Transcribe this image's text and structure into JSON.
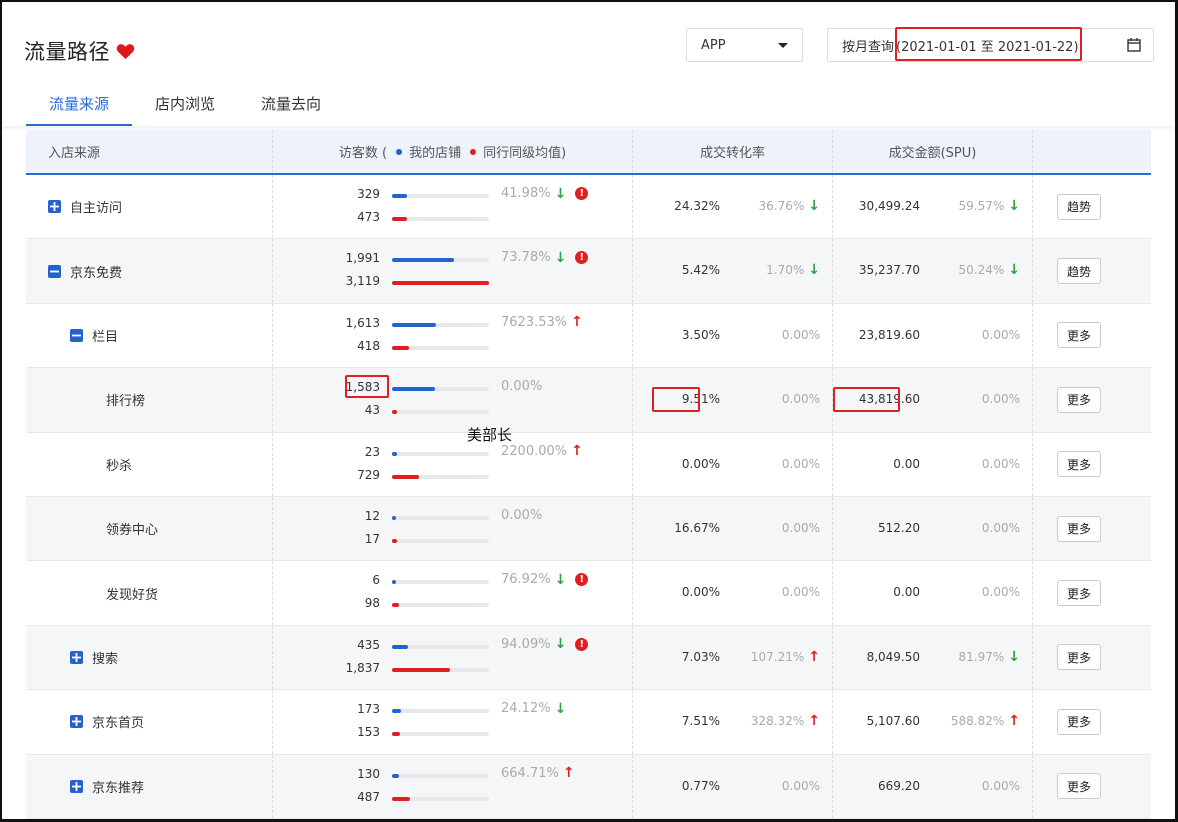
{
  "title": "流量路径",
  "platform_select": "APP",
  "date": {
    "mode": "按月查询",
    "range": "(2021-01-01 至 2021-01-22)"
  },
  "tabs": [
    "流量来源",
    "店内浏览",
    "流量去向"
  ],
  "columns": {
    "source": "入店来源",
    "visitors_prefix": "访客数 (",
    "legend_mine": "我的店铺",
    "legend_peer": "同行同级均值)",
    "conversion": "成交转化率",
    "amount": "成交金额(SPU)"
  },
  "colors": {
    "accent": "#2b6bd6",
    "mine": "#2462cf",
    "peer": "#e02020",
    "down": "#2aa44a",
    "up": "#e02020"
  },
  "watermark": "美部长",
  "rows": [
    {
      "name": "自主访问",
      "expander": "plus",
      "v_mine": "329",
      "v_peer": "473",
      "fill_mine": 0.15,
      "fill_peer": 0.15,
      "v_pct": "41.98%",
      "v_trend": "down",
      "warn": true,
      "conv": "24.32%",
      "conv_pct": "36.76%",
      "conv_trend": "down",
      "amount": "30,499.24",
      "amount_pct": "59.57%",
      "amount_trend": "down",
      "action": "趋势"
    },
    {
      "name": "京东免费",
      "expander": "minus",
      "v_mine": "1,991",
      "v_peer": "3,119",
      "fill_mine": 0.64,
      "fill_peer": 1.0,
      "v_pct": "73.78%",
      "v_trend": "down",
      "warn": true,
      "conv": "5.42%",
      "conv_pct": "1.70%",
      "conv_trend": "down",
      "amount": "35,237.70",
      "amount_pct": "50.24%",
      "amount_trend": "down",
      "action": "趋势"
    },
    {
      "name": "栏目",
      "expander": "minus",
      "v_mine": "1,613",
      "v_peer": "418",
      "fill_mine": 0.45,
      "fill_peer": 0.18,
      "v_pct": "7623.53%",
      "v_trend": "up",
      "warn": false,
      "conv": "3.50%",
      "conv_pct": "0.00%",
      "conv_trend": "",
      "amount": "23,819.60",
      "amount_pct": "0.00%",
      "amount_trend": "",
      "action": "更多"
    },
    {
      "name": "排行榜",
      "expander": "",
      "v_mine": "1,583",
      "v_peer": "43",
      "fill_mine": 0.44,
      "fill_peer": 0.05,
      "v_pct": "0.00%",
      "v_trend": "",
      "warn": false,
      "conv": "9.51%",
      "conv_pct": "0.00%",
      "conv_trend": "",
      "amount": "43,819.60",
      "amount_pct": "0.00%",
      "amount_trend": "",
      "action": "更多"
    },
    {
      "name": "秒杀",
      "expander": "",
      "v_mine": "23",
      "v_peer": "729",
      "fill_mine": 0.05,
      "fill_peer": 0.28,
      "v_pct": "2200.00%",
      "v_trend": "up",
      "warn": false,
      "conv": "0.00%",
      "conv_pct": "0.00%",
      "conv_trend": "",
      "amount": "0.00",
      "amount_pct": "0.00%",
      "amount_trend": "",
      "action": "更多"
    },
    {
      "name": "领券中心",
      "expander": "",
      "v_mine": "12",
      "v_peer": "17",
      "fill_mine": 0.02,
      "fill_peer": 0.05,
      "v_pct": "0.00%",
      "v_trend": "",
      "warn": false,
      "conv": "16.67%",
      "conv_pct": "0.00%",
      "conv_trend": "",
      "amount": "512.20",
      "amount_pct": "0.00%",
      "amount_trend": "",
      "action": "更多"
    },
    {
      "name": "发现好货",
      "expander": "",
      "v_mine": "6",
      "v_peer": "98",
      "fill_mine": 0.02,
      "fill_peer": 0.07,
      "v_pct": "76.92%",
      "v_trend": "down",
      "warn": true,
      "conv": "0.00%",
      "conv_pct": "0.00%",
      "conv_trend": "",
      "amount": "0.00",
      "amount_pct": "0.00%",
      "amount_trend": "",
      "action": "更多"
    },
    {
      "name": "搜索",
      "expander": "plus",
      "v_mine": "435",
      "v_peer": "1,837",
      "fill_mine": 0.17,
      "fill_peer": 0.6,
      "v_pct": "94.09%",
      "v_trend": "down",
      "warn": true,
      "conv": "7.03%",
      "conv_pct": "107.21%",
      "conv_trend": "up",
      "amount": "8,049.50",
      "amount_pct": "81.97%",
      "amount_trend": "down",
      "action": "更多"
    },
    {
      "name": "京东首页",
      "expander": "plus",
      "v_mine": "173",
      "v_peer": "153",
      "fill_mine": 0.09,
      "fill_peer": 0.08,
      "v_pct": "24.12%",
      "v_trend": "down",
      "warn": false,
      "conv": "7.51%",
      "conv_pct": "328.32%",
      "conv_trend": "up",
      "amount": "5,107.60",
      "amount_pct": "588.82%",
      "amount_trend": "up",
      "action": "更多"
    },
    {
      "name": "京东推荐",
      "expander": "plus",
      "v_mine": "130",
      "v_peer": "487",
      "fill_mine": 0.07,
      "fill_peer": 0.19,
      "v_pct": "664.71%",
      "v_trend": "up",
      "warn": false,
      "conv": "0.77%",
      "conv_pct": "0.00%",
      "conv_trend": "",
      "amount": "669.20",
      "amount_pct": "0.00%",
      "amount_trend": "",
      "action": "更多"
    }
  ]
}
